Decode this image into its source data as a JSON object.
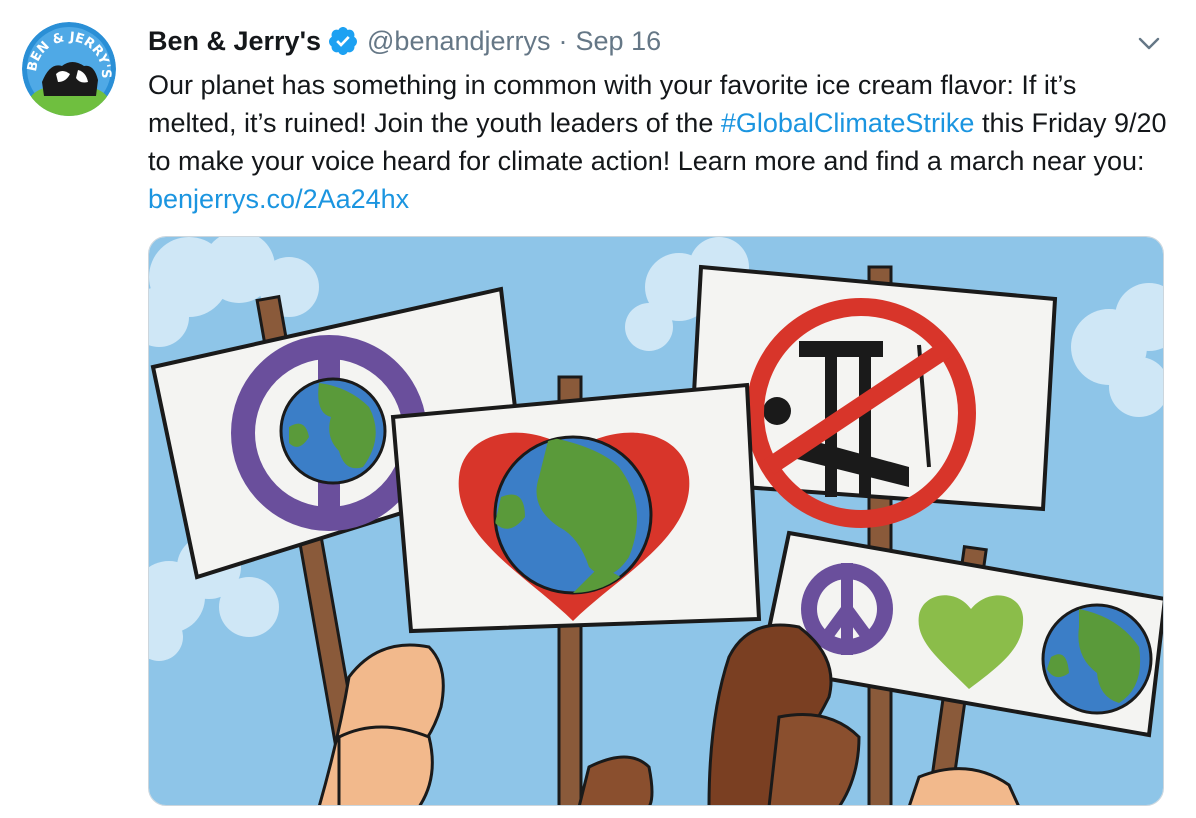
{
  "tweet": {
    "display_name": "Ben & Jerry's",
    "handle": "@benandjerrys",
    "separator": "·",
    "date": "Sep 16",
    "text_part1": "Our planet has something in common with your favorite ice cream flavor: If it’s melted, it’s ruined! Join the youth leaders of the ",
    "hashtag": "#GlobalClimateStrike",
    "text_part2": " this Friday 9/20 to make your voice heard for climate action! Learn more and find a march near you: ",
    "link": "benjerrys.co/2Aa24hx",
    "avatar_text": "BEN & JERRY'S"
  },
  "icons": {
    "verified": "verified-badge-icon",
    "more": "chevron-down-icon"
  },
  "colors": {
    "link": "#1b95e0",
    "verified": "#1da1f2",
    "secondary_text": "#657786",
    "sky": "#8ec5e8",
    "peace_purple": "#6a4f9c",
    "heart_red": "#d8352a",
    "heart_green": "#8bbd4a"
  }
}
